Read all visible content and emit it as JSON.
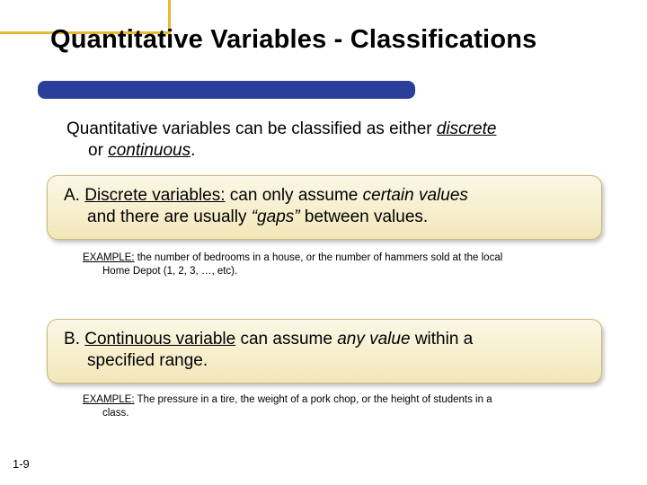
{
  "title": "Quantitative Variables - Classifications",
  "intro": {
    "line1": "Quantitative variables can be classified as either ",
    "discrete": "discrete",
    "or": "or ",
    "continuous": "continuous",
    "period": "."
  },
  "box_a": {
    "label": "A. ",
    "term": "Discrete variables:",
    "text1": " can only assume ",
    "em1": "certain values",
    "text2": "and there are usually ",
    "em2": "“gaps”",
    "text3": " between values."
  },
  "example_a": {
    "label": "EXAMPLE:",
    "text1": " the number of bedrooms in a house, or the number of hammers sold at the local",
    "text2": "Home Depot (1, 2, 3, …, etc)."
  },
  "box_b": {
    "label": "B",
    "dot": ". ",
    "term": "Continuous variable",
    "text1": " can assume ",
    "em1": "any value",
    "text2": " within a",
    "text3": "specified range."
  },
  "example_b": {
    "label": "EXAMPLE:",
    "text1": " The pressure in a tire, the weight of a pork chop, or the height of students in a",
    "text2": "class."
  },
  "page_number": "1-9"
}
